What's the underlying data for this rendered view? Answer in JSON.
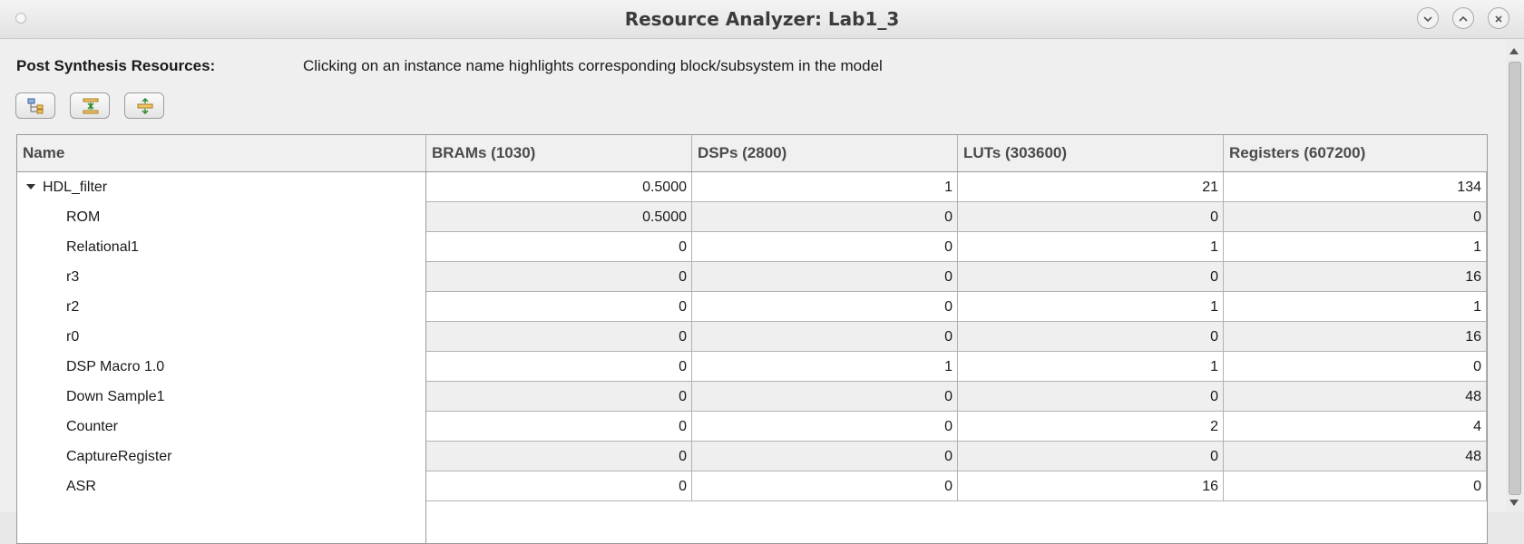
{
  "window": {
    "title": "Resource Analyzer: Lab1_3"
  },
  "header": {
    "label": "Post Synthesis Resources:",
    "hint": "Clicking on an instance name highlights corresponding block/subsystem in the model"
  },
  "toolbar": {
    "buttons": [
      {
        "icon": "tree-hierarchy-icon"
      },
      {
        "icon": "collapse-all-icon"
      },
      {
        "icon": "expand-all-icon"
      }
    ]
  },
  "table": {
    "columns": [
      "Name",
      "BRAMs (1030)",
      "DSPs (2800)",
      "LUTs (303600)",
      "Registers (607200)"
    ],
    "rows": [
      {
        "name": "HDL_filter",
        "brams": "0.5000",
        "dsps": "1",
        "luts": "21",
        "registers": "134"
      },
      {
        "name": "ROM",
        "brams": "0.5000",
        "dsps": "0",
        "luts": "0",
        "registers": "0"
      },
      {
        "name": "Relational1",
        "brams": "0",
        "dsps": "0",
        "luts": "1",
        "registers": "1"
      },
      {
        "name": "r3",
        "brams": "0",
        "dsps": "0",
        "luts": "0",
        "registers": "16"
      },
      {
        "name": "r2",
        "brams": "0",
        "dsps": "0",
        "luts": "1",
        "registers": "1"
      },
      {
        "name": "r0",
        "brams": "0",
        "dsps": "0",
        "luts": "0",
        "registers": "16"
      },
      {
        "name": "DSP Macro 1.0",
        "brams": "0",
        "dsps": "1",
        "luts": "1",
        "registers": "0"
      },
      {
        "name": "Down Sample1",
        "brams": "0",
        "dsps": "0",
        "luts": "0",
        "registers": "48"
      },
      {
        "name": "Counter",
        "brams": "0",
        "dsps": "0",
        "luts": "2",
        "registers": "4"
      },
      {
        "name": "CaptureRegister",
        "brams": "0",
        "dsps": "0",
        "luts": "0",
        "registers": "48"
      },
      {
        "name": "ASR",
        "brams": "0",
        "dsps": "0",
        "luts": "16",
        "registers": "0"
      }
    ]
  }
}
